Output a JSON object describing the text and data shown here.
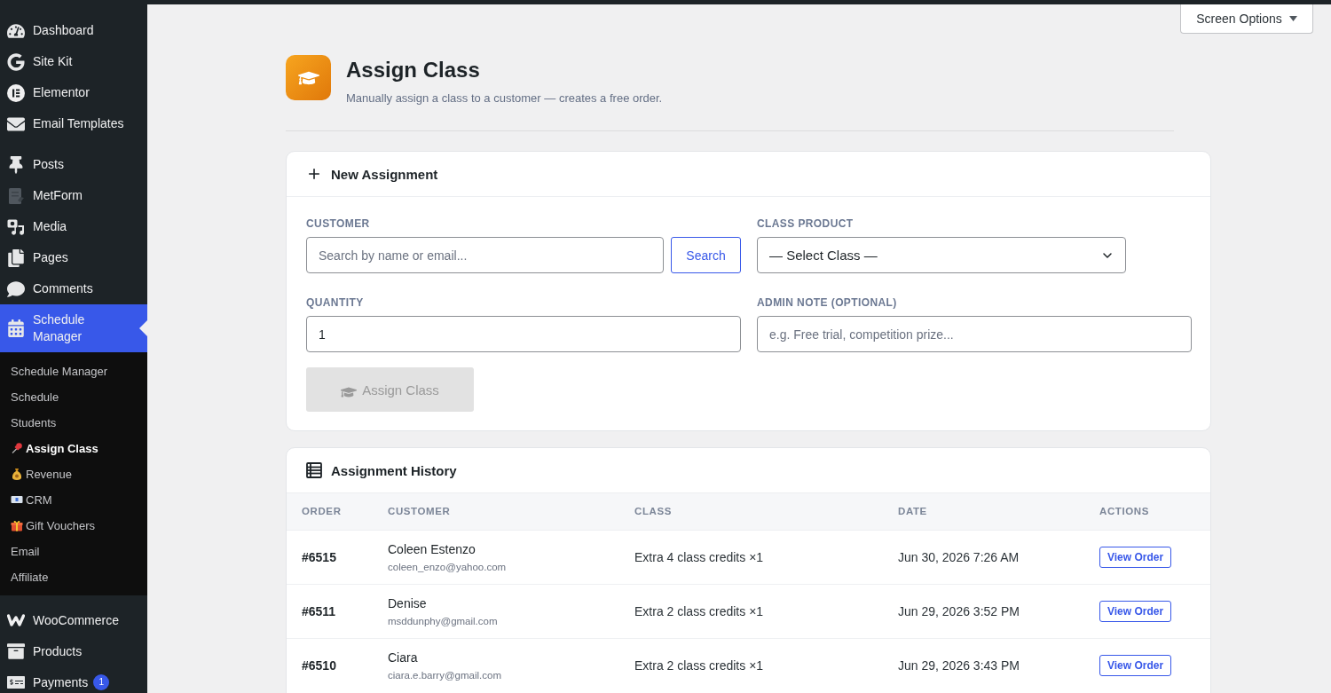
{
  "admin_menu": {
    "groups": [
      {
        "items": [
          {
            "label": "Dashboard",
            "selected": false
          },
          {
            "label": "Site Kit",
            "selected": false
          },
          {
            "label": "Elementor",
            "selected": false
          },
          {
            "label": "Email Templates",
            "selected": false
          }
        ]
      },
      {
        "items": [
          {
            "label": "Posts",
            "selected": false
          },
          {
            "label": "MetForm",
            "selected": false
          },
          {
            "label": "Media",
            "selected": false
          },
          {
            "label": "Pages",
            "selected": false
          },
          {
            "label": "Comments",
            "selected": false
          },
          {
            "label": "Schedule Manager",
            "selected": true,
            "expanded": true,
            "children": [
              {
                "label": "Schedule Manager",
                "selected": false
              },
              {
                "label": "Schedule",
                "selected": false
              },
              {
                "label": "Students",
                "selected": false
              },
              {
                "label": "Assign Class",
                "selected": true
              },
              {
                "label": "Revenue",
                "selected": false
              },
              {
                "label": "CRM",
                "selected": false
              },
              {
                "label": "Gift Vouchers",
                "selected": false
              },
              {
                "label": "Email",
                "selected": false
              },
              {
                "label": "Affiliate",
                "selected": false
              }
            ]
          }
        ]
      },
      {
        "items": [
          {
            "label": "WooCommerce",
            "selected": false
          },
          {
            "label": "Products",
            "selected": false
          },
          {
            "label": "Payments",
            "selected": false,
            "badge": "1"
          }
        ]
      }
    ]
  },
  "screen_options": {
    "label": "Screen Options"
  },
  "page_header": {
    "title": "Assign Class",
    "subtitle": "Manually assign a class to a customer — creates a free order."
  },
  "new_assignment": {
    "title": "New Assignment",
    "customer": {
      "label": "CUSTOMER",
      "placeholder": "Search by name or email...",
      "button": "Search"
    },
    "class_product": {
      "label": "CLASS PRODUCT",
      "value": "— Select Class —"
    },
    "quantity": {
      "label": "QUANTITY",
      "value": "1"
    },
    "admin_note": {
      "label": "ADMIN NOTE (OPTIONAL)",
      "placeholder": "e.g. Free trial, competition prize..."
    },
    "submit": {
      "label": "Assign Class",
      "disabled": true
    }
  },
  "history": {
    "title": "Assignment History",
    "columns": [
      "ORDER",
      "CUSTOMER",
      "CLASS",
      "DATE",
      "ACTIONS"
    ],
    "rows": [
      {
        "order": "#6515",
        "customer_name": "Coleen Estenzo",
        "customer_email": "coleen_enzo@yahoo.com",
        "class": "Extra 4 class credits ×1",
        "date": "Jun 30, 2026 7:26 AM",
        "action": "View Order"
      },
      {
        "order": "#6511",
        "customer_name": "Denise",
        "customer_email": "msddunphy@gmail.com",
        "class": "Extra 2 class credits ×1",
        "date": "Jun 29, 2026 3:52 PM",
        "action": "View Order"
      },
      {
        "order": "#6510",
        "customer_name": "Ciara",
        "customer_email": "ciara.e.barry@gmail.com",
        "class": "Extra 2 class credits ×1",
        "date": "Jun 29, 2026 3:43 PM",
        "action": "View Order"
      }
    ]
  }
}
